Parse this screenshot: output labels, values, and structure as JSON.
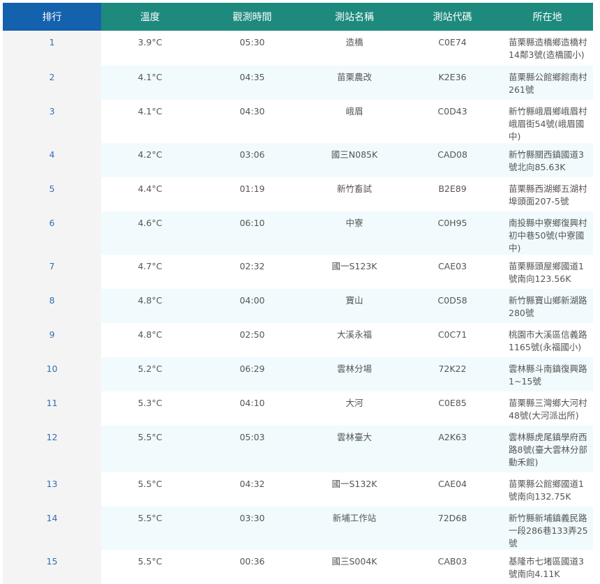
{
  "headers": {
    "rank": "排行",
    "temp": "溫度",
    "time": "觀測時間",
    "station_name": "測站名稱",
    "station_code": "測站代碼",
    "location": "所在地"
  },
  "rows": [
    {
      "rank": "1",
      "temp": "3.9°C",
      "time": "05:30",
      "name": "造橋",
      "code": "C0E74",
      "location": "苗栗縣造橋鄉造橋村14鄰3號(造橋國小)"
    },
    {
      "rank": "2",
      "temp": "4.1°C",
      "time": "04:35",
      "name": "苗栗農改",
      "code": "K2E36",
      "location": "苗栗縣公館鄉館南村261號"
    },
    {
      "rank": "3",
      "temp": "4.1°C",
      "time": "04:30",
      "name": "峨眉",
      "code": "C0D43",
      "location": "新竹縣峨眉鄉峨眉村峨眉街54號(峨眉國中)"
    },
    {
      "rank": "4",
      "temp": "4.2°C",
      "time": "03:06",
      "name": "國三N085K",
      "code": "CAD08",
      "location": "新竹縣關西鎮國道3號北向85.63K"
    },
    {
      "rank": "5",
      "temp": "4.4°C",
      "time": "01:19",
      "name": "新竹畜試",
      "code": "B2E89",
      "location": "苗栗縣西湖鄉五湖村埠頭面207-5號"
    },
    {
      "rank": "6",
      "temp": "4.6°C",
      "time": "06:10",
      "name": "中寮",
      "code": "C0H95",
      "location": "南投縣中寮鄉復興村初中巷50號(中寮國中)"
    },
    {
      "rank": "7",
      "temp": "4.7°C",
      "time": "02:32",
      "name": "國一S123K",
      "code": "CAE03",
      "location": "苗栗縣頭屋鄉國道1號南向123.56K"
    },
    {
      "rank": "8",
      "temp": "4.8°C",
      "time": "04:00",
      "name": "寶山",
      "code": "C0D58",
      "location": "新竹縣寶山鄉新湖路280號"
    },
    {
      "rank": "9",
      "temp": "4.8°C",
      "time": "02:50",
      "name": "大溪永福",
      "code": "C0C71",
      "location": "桃園市大溪區信義路1165號(永福國小)"
    },
    {
      "rank": "10",
      "temp": "5.2°C",
      "time": "06:29",
      "name": "雲林分場",
      "code": "72K22",
      "location": "雲林縣斗南鎮復興路1~15號"
    },
    {
      "rank": "11",
      "temp": "5.3°C",
      "time": "04:10",
      "name": "大河",
      "code": "C0E85",
      "location": "苗栗縣三灣鄉大河村48號(大河派出所)"
    },
    {
      "rank": "12",
      "temp": "5.5°C",
      "time": "05:03",
      "name": "雲林臺大",
      "code": "A2K63",
      "location": "雲林縣虎尾鎮學府西路8號(臺大雲林分部動禾館)"
    },
    {
      "rank": "13",
      "temp": "5.5°C",
      "time": "04:32",
      "name": "國一S132K",
      "code": "CAE04",
      "location": "苗栗縣公館鄉國道1號南向132.75K"
    },
    {
      "rank": "14",
      "temp": "5.5°C",
      "time": "03:30",
      "name": "新埔工作站",
      "code": "72D68",
      "location": "新竹縣新埔鎮義民路一段286巷133弄25號"
    },
    {
      "rank": "15",
      "temp": "5.5°C",
      "time": "00:36",
      "name": "國三S004K",
      "code": "CAB03",
      "location": "基隆市七堵區國道3號南向4.11K"
    }
  ]
}
